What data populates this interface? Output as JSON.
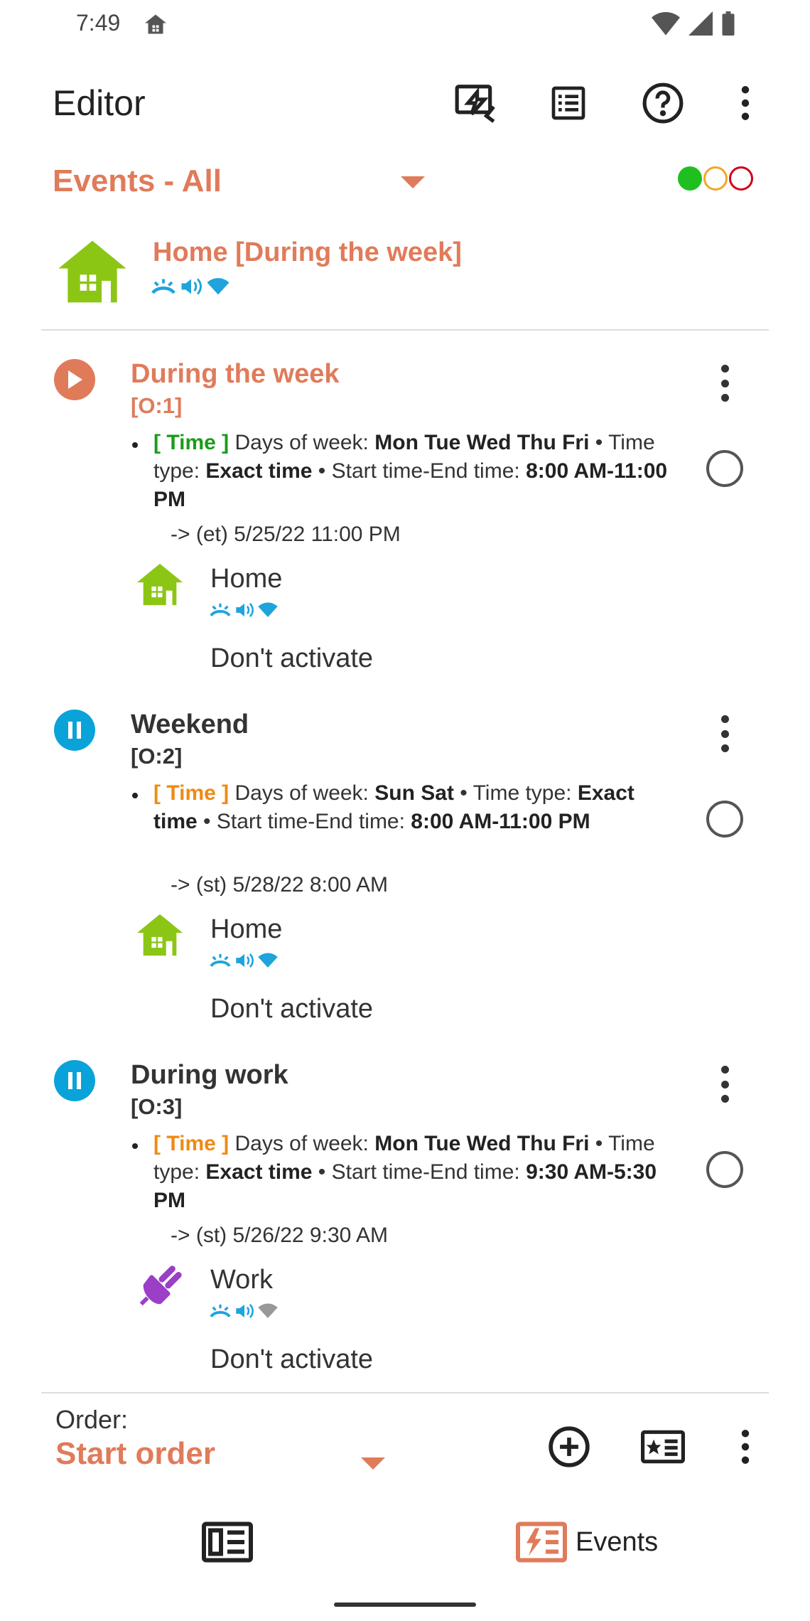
{
  "status_bar": {
    "time": "7:49"
  },
  "app_bar": {
    "title": "Editor",
    "icons": [
      "activity-log-icon",
      "list-icon",
      "help-icon",
      "overflow-menu-icon"
    ]
  },
  "filter": {
    "label": "Events - All",
    "status_dots": [
      "#1fbf1f",
      "#f5a623",
      "#d0021b"
    ]
  },
  "active_profile": {
    "name": "Home [During the week]"
  },
  "colors": {
    "accent": "#e07b5a",
    "running": "#e07b5a",
    "paused": "#0aa3d9",
    "tag_green": "#1a9c1a",
    "tag_orange": "#f08a12",
    "home_green": "#8cc614",
    "work_purple": "#9b3ec8",
    "mini_blue": "#1fa4dc"
  },
  "events": [
    {
      "name": "During the week",
      "order": "[O:1]",
      "state": "running",
      "tag": "[ Time ]",
      "days_label": "Days of week:",
      "days": "Mon Tue Wed Thu Fri",
      "type_label": "Time type:",
      "type": "Exact time",
      "range_label": "Start time-End time:",
      "range": "8:00 AM-11:00 PM",
      "next": "-> (et) 5/25/22 11:00 PM",
      "profile": "Home",
      "after": "Don't activate"
    },
    {
      "name": "Weekend",
      "order": "[O:2]",
      "state": "paused",
      "tag": "[ Time ]",
      "days_label": "Days of week:",
      "days": "Sun Sat",
      "type_label": "Time type:",
      "type": "Exact time",
      "range_label": "Start time-End time:",
      "range": "8:00 AM-11:00 PM",
      "next": "-> (st) 5/28/22 8:00 AM",
      "profile": "Home",
      "after": "Don't activate"
    },
    {
      "name": "During work",
      "order": "[O:3]",
      "state": "paused",
      "tag": "[ Time ]",
      "days_label": "Days of week:",
      "days": "Mon Tue Wed Thu Fri",
      "type_label": "Time type:",
      "type": "Exact time",
      "range_label": "Start time-End time:",
      "range": "9:30 AM-5:30 PM",
      "next": "-> (st) 5/26/22 9:30 AM",
      "profile": "Work",
      "after": "Don't activate"
    }
  ],
  "order_bar": {
    "label": "Order:",
    "value": "Start order"
  },
  "bottom_nav": {
    "events_label": "Events"
  }
}
